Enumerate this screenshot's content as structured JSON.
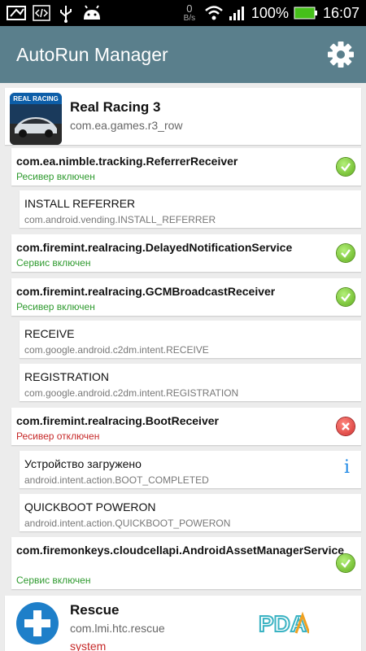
{
  "status_bar": {
    "net_speed": "0",
    "net_unit": "B/s",
    "battery": "100%",
    "time": "16:07"
  },
  "app_bar": {
    "title": "AutoRun Manager",
    "settings_icon": "gear-icon"
  },
  "apps": [
    {
      "name": "Real Racing 3",
      "package": "com.ea.games.r3_row",
      "icon_text": "REAL RACING",
      "components": [
        {
          "name": "com.ea.nimble.tracking.ReferrerReceiver",
          "status": "Ресивер включен",
          "enabled": true,
          "filters": [
            {
              "name": "INSTALL REFERRER",
              "action": "com.android.vending.INSTALL_REFERRER"
            }
          ]
        },
        {
          "name": "com.firemint.realracing.DelayedNotificationService",
          "status": "Сервис включен",
          "enabled": true,
          "filters": []
        },
        {
          "name": "com.firemint.realracing.GCMBroadcastReceiver",
          "status": "Ресивер включен",
          "enabled": true,
          "filters": [
            {
              "name": "RECEIVE",
              "action": "com.google.android.c2dm.intent.RECEIVE"
            },
            {
              "name": "REGISTRATION",
              "action": "com.google.android.c2dm.intent.REGISTRATION"
            }
          ]
        },
        {
          "name": "com.firemint.realracing.BootReceiver",
          "status": "Ресивер отключен",
          "enabled": false,
          "filters": [
            {
              "name": "Устройство загружено",
              "action": "android.intent.action.BOOT_COMPLETED",
              "info": "i"
            },
            {
              "name": "QUICKBOOT POWERON",
              "action": "android.intent.action.QUICKBOOT_POWERON"
            }
          ]
        },
        {
          "name": "com.firemonkeys.cloudcellapi.AndroidAssetManagerService",
          "status": "Сервис включен",
          "enabled": true,
          "filters": []
        }
      ]
    },
    {
      "name": "Rescue",
      "package": "com.lmi.htc.rescue",
      "subtitle": "system",
      "badge": "PDA"
    }
  ],
  "colors": {
    "app_bar": "#5a7f8c",
    "enabled": "#2e9a2e",
    "disabled": "#c62828",
    "background": "#ececec"
  }
}
